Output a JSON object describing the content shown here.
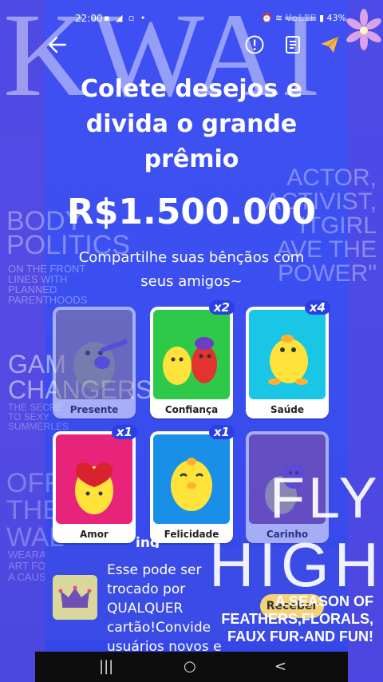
{
  "status_bar": {
    "time": "22:00",
    "left_icons": "▪ ◢ ▫ •",
    "right_icons": "⏰ ≋ 𝚅𝚘𝙻𝚃𝙴 ▮ 43%"
  },
  "overlay": {
    "kwai": "KWAI",
    "body_politics": "BODY\nPOLITICS",
    "body_politics_small": "ON THE FRONT\nLINES WITH\nPLANNED\nPARENTHOODS",
    "actor": "ACTOR,\nACTIVIST,\nITGIRL\nAVE THE\nPOWER\"",
    "game_changers": "GAM\nCHANGERS",
    "game_changers_small": "THE SECRE\nTO SEXY\nSUMMERLES",
    "off_the_wall": "OFF\nTHE\nWAL",
    "wearable": "WEARABLE\nART FOR\nA CAUSE",
    "fly": "FLY",
    "high": "HIGH",
    "season": "A SEASON OF\nFEATHERS,FLORALS,\nFAUX FUR-AND FUN!"
  },
  "header": {
    "back_icon": "arrow-left-icon",
    "info_icon": "info-circle-icon",
    "rules_icon": "document-icon",
    "share_icon": "paper-plane-icon"
  },
  "hero": {
    "title": "Colete desejos e divida o grande prêmio",
    "prize": "R$1.500.000",
    "subtitle": "Compartilhe suas bênçãos com seus amigos~"
  },
  "cards": [
    {
      "label": "Presente",
      "badge": "",
      "bg": "#8e7f9a",
      "owned": false
    },
    {
      "label": "Confiança",
      "badge": "x2",
      "bg": "#2fc94a",
      "owned": true
    },
    {
      "label": "Saúde",
      "badge": "x4",
      "bg": "#19c6e6",
      "owned": true
    },
    {
      "label": "Amor",
      "badge": "x1",
      "bg": "#e8237a",
      "owned": true
    },
    {
      "label": "Felicidade",
      "badge": "x1",
      "bg": "#1a8fe8",
      "owned": true
    },
    {
      "label": "Carinho",
      "badge": "",
      "bg": "#8a4fa0",
      "owned": false
    }
  ],
  "bottom": {
    "partial_heading": "ing",
    "reward_text": "Esse pode ser trocado por QUALQUER cartão!Convide usuários novos e",
    "receive_button": "Receber"
  },
  "navbar": {
    "recent": "|||",
    "home": "○",
    "back": "<"
  }
}
